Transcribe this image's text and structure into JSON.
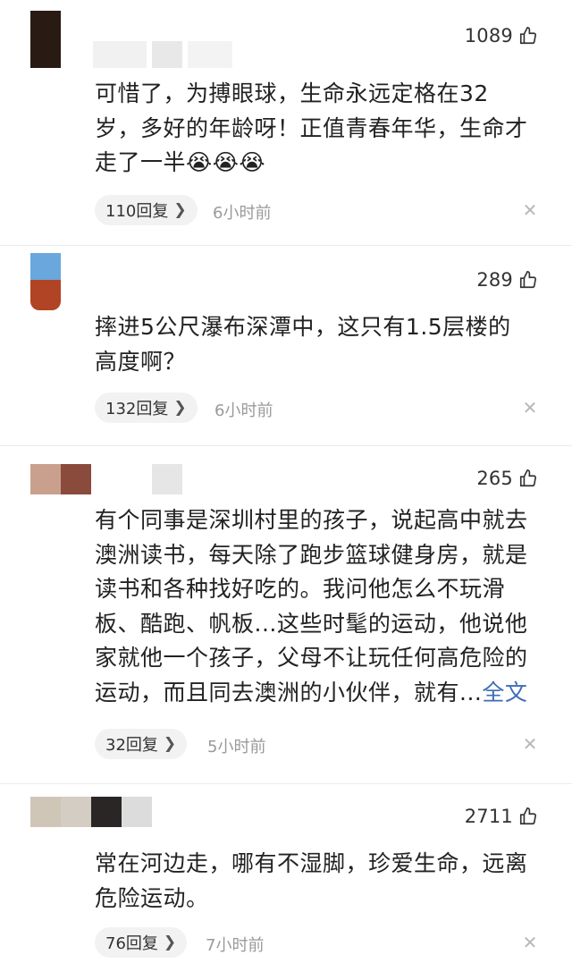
{
  "comments": [
    {
      "likes": "1089",
      "lines": [
        "可惜了，为搏眼球，生命永远定格在32",
        "岁，多好的年龄呀！正值青春年华，生命才",
        "走了一半😭😭😭"
      ],
      "reply_label": "110回复",
      "time": "6小时前",
      "avatar_colors": [
        "#2a1a14",
        "#dcdcdc",
        "#ececec"
      ]
    },
    {
      "likes": "289",
      "lines": [
        "摔进5公尺瀑布深潭中，这只有1.5层楼的",
        "高度啊？"
      ],
      "reply_label": "132回复",
      "time": "6小时前",
      "avatar_colors": [
        "#6aa7dd",
        "#b04424"
      ]
    },
    {
      "likes": "265",
      "lines": [
        "有个同事是深圳村里的孩子，说起高中就去",
        "澳洲读书，每天除了跑步篮球健身房，就是",
        "读书和各种找好吃的。我问他怎么不玩滑",
        "板、酷跑、帆板...这些时髦的运动，他说他",
        "家就他一个孩子，父母不让玩任何高危险的",
        "运动，而且同去澳洲的小伙伴，就有..."
      ],
      "full_text_label": "全文",
      "reply_label": "32回复",
      "time": "5小时前",
      "avatar_colors": [
        "#c9a08e",
        "#8a4a3c",
        "#e6e6e6"
      ]
    },
    {
      "likes": "2711",
      "lines": [
        "常在河边走，哪有不湿脚，珍爱生命，远离",
        "危险运动。"
      ],
      "reply_label": "76回复",
      "time": "7小时前",
      "avatar_colors": [
        "#cfc6b8",
        "#d3cdc3",
        "#2a2626",
        "#dcdcdc"
      ]
    }
  ],
  "icons": {
    "like": "thumbs-up-icon",
    "reply_arrow": "chevron-right-icon",
    "dismiss": "close-icon"
  },
  "colors": {
    "link": "#3d6db5",
    "time": "#9a9a9a",
    "pill_bg": "#f2f2f2"
  }
}
